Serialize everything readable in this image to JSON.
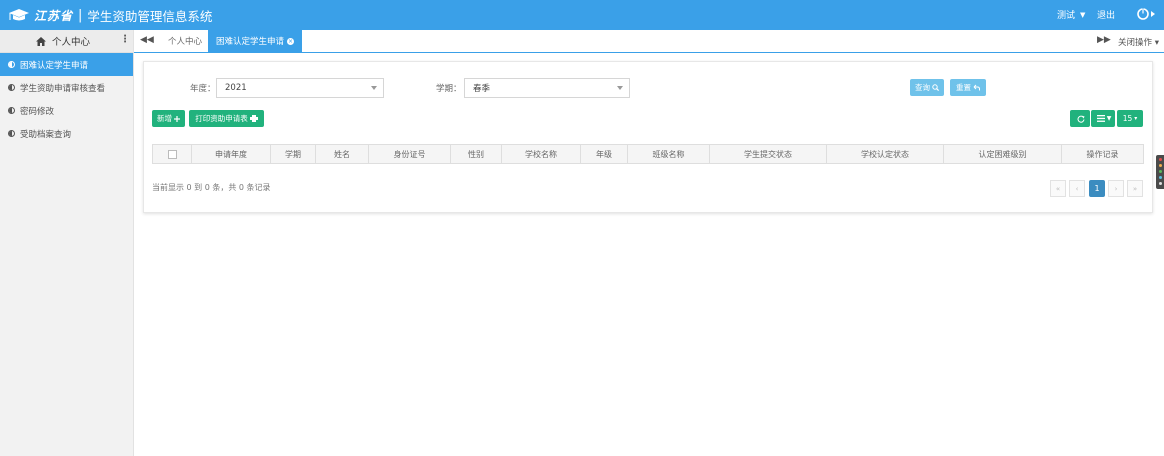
{
  "header": {
    "brand_province": "江苏省",
    "brand_separator": "|",
    "system_name": "学生资助管理信息系统",
    "user_name": "测试",
    "logout_label": "退出",
    "accent_color": "#3aa0e8"
  },
  "sidebar": {
    "title": "个人中心",
    "items": [
      {
        "label": "困难认定学生申请",
        "active": true
      },
      {
        "label": "学生资助申请审核查看",
        "active": false
      },
      {
        "label": "密码修改",
        "active": false
      },
      {
        "label": "受助档案查询",
        "active": false
      }
    ]
  },
  "tabs": {
    "items": [
      {
        "label": "个人中心"
      },
      {
        "label": "困难认定学生申请"
      }
    ],
    "close_ops_label": "关闭操作"
  },
  "filters": {
    "year_label": "年度：",
    "year_value": "2021",
    "term_label": "学期：",
    "term_value": "春季",
    "query_label": "查询",
    "reset_label": "重置"
  },
  "toolbar": {
    "add_label": "新增",
    "print_label": "打印资助申请表",
    "page_size": "15"
  },
  "table": {
    "columns": [
      "申请年度",
      "学期",
      "姓名",
      "身份证号",
      "性别",
      "学校名称",
      "年级",
      "班级名称",
      "学生提交状态",
      "学校认定状态",
      "认定困难级别",
      "操作记录"
    ],
    "rows": []
  },
  "footer": {
    "summary": "当前显示 0 到 0 条，共 0 条记录",
    "first": "«",
    "prev": "‹",
    "current_page": "1",
    "next": "›",
    "last": "»"
  }
}
